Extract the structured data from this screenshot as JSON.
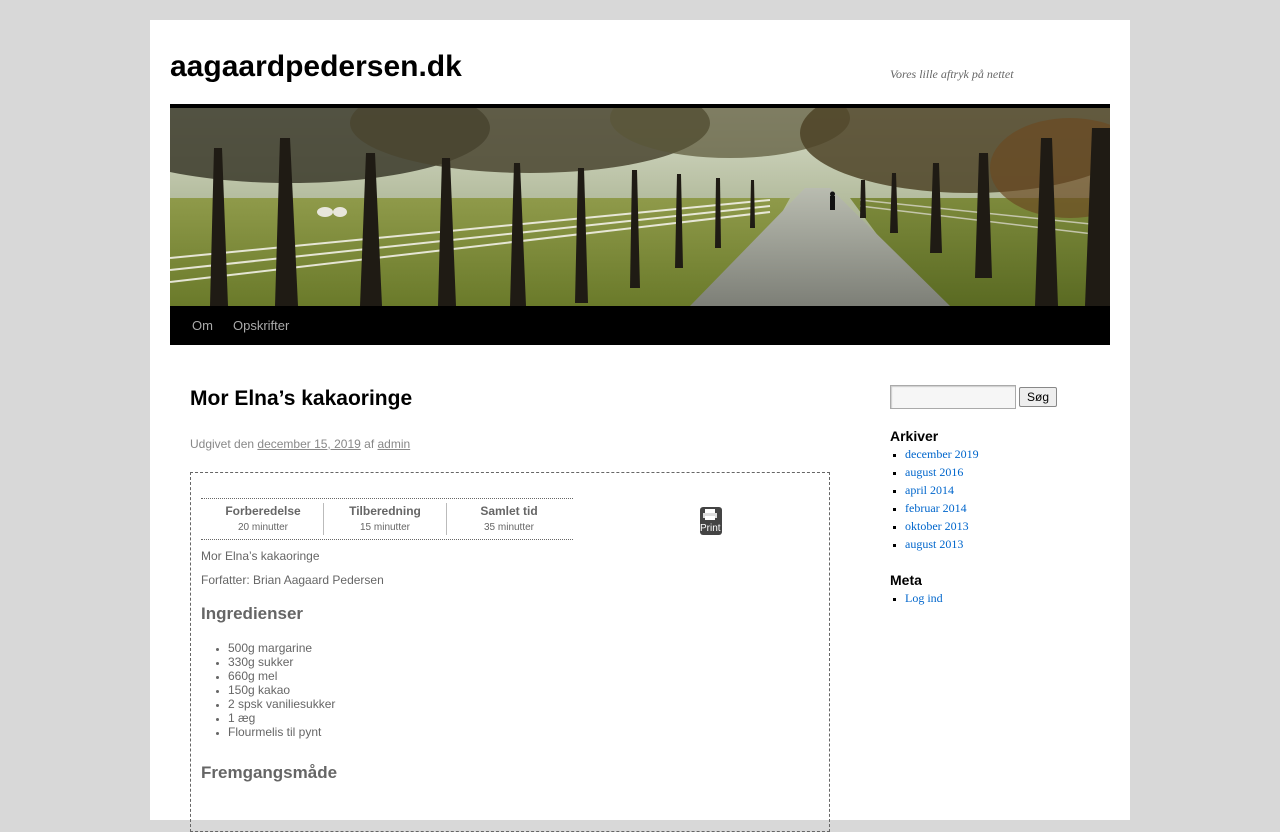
{
  "site": {
    "title": "aagaardpedersen.dk",
    "description": "Vores lille aftryk på nettet"
  },
  "menu": {
    "items": [
      {
        "label": "Om"
      },
      {
        "label": "Opskrifter"
      }
    ]
  },
  "post": {
    "title": "Mor Elna’s kakaoringe",
    "meta_prefix": "Udgivet den",
    "date": "december 15, 2019",
    "meta_by": "af",
    "author": "admin"
  },
  "recipe": {
    "times": [
      {
        "label": "Forberedelse",
        "value": "20 minutter"
      },
      {
        "label": "Tilberedning",
        "value": "15 minutter"
      },
      {
        "label": "Samlet tid",
        "value": "35 minutter"
      }
    ],
    "print_label": "Print",
    "name": "Mor Elna’s kakaoringe",
    "author_line": "Forfatter: Brian Aagaard Pedersen",
    "ingredients_title": "Ingredienser",
    "ingredients": [
      "500g margarine",
      "330g sukker",
      "660g mel",
      "150g kakao",
      "2 spsk vaniliesukker",
      "1 æg",
      "Flourmelis til pynt"
    ],
    "method_title": "Fremgangsmåde"
  },
  "sidebar": {
    "search_button": "Søg",
    "search_value": "",
    "archives_title": "Arkiver",
    "archives": [
      "december 2019",
      "august 2016",
      "april 2014",
      "februar 2014",
      "oktober 2013",
      "august 2013"
    ],
    "meta_title": "Meta",
    "meta_links": [
      "Log ind"
    ]
  },
  "colors": {
    "page_background": "#d8d8d8",
    "link": "#0066cc",
    "menu_bar": "#000000"
  }
}
